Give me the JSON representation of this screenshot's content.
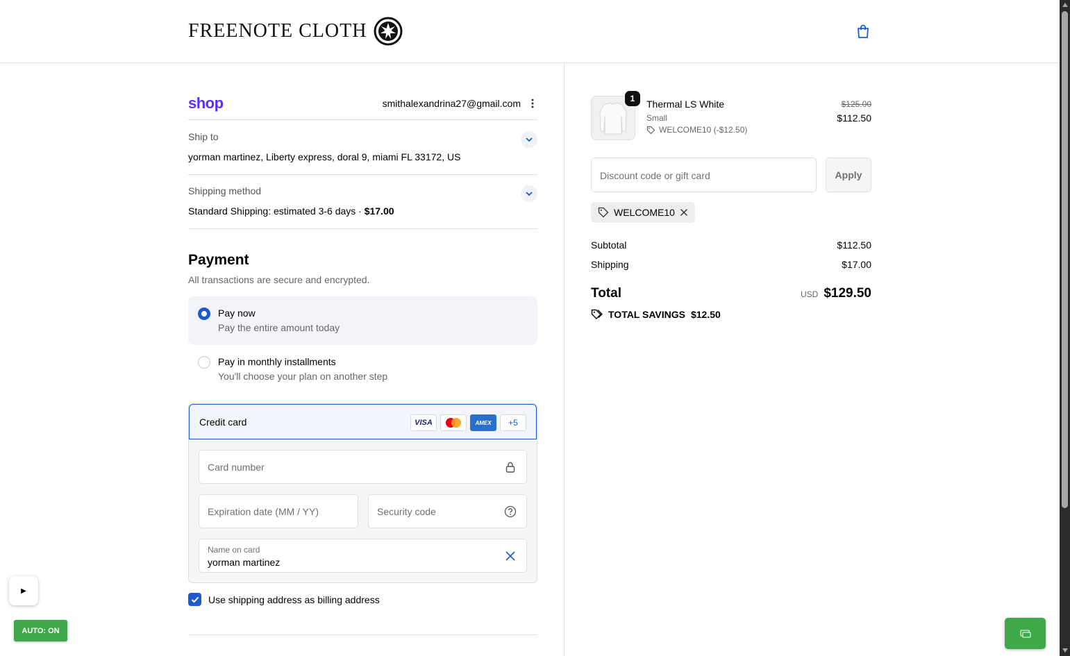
{
  "header": {
    "logo": "FREENOTE CLOTH",
    "cart_icon": "shopping-bag-icon"
  },
  "account": {
    "shop_logo": "shop",
    "email": "smithalexandrina27@gmail.com",
    "menu_icon": "kebab-menu-icon"
  },
  "ship_to": {
    "label": "Ship to",
    "value": "yorman martinez, Liberty express, doral 9, miami FL 33172, US"
  },
  "shipping_method": {
    "label": "Shipping method",
    "value": "Standard Shipping: estimated 3-6 days · ",
    "price": "$17.00"
  },
  "payment": {
    "title": "Payment",
    "subtitle": "All transactions are secure and encrypted.",
    "options": [
      {
        "title": "Pay now",
        "subtitle": "Pay the entire amount today",
        "selected": true
      },
      {
        "title": "Pay in monthly installments",
        "subtitle": "You'll choose your plan on another step",
        "selected": false
      }
    ],
    "credit_card": {
      "title": "Credit card",
      "brands": [
        "VISA",
        "Mastercard",
        "AMEX",
        "+5"
      ],
      "card_number_placeholder": "Card number",
      "expiration_placeholder": "Expiration date (MM / YY)",
      "security_placeholder": "Security code",
      "name_label": "Name on card",
      "name_value": "yorman martinez"
    },
    "billing_checkbox_label": "Use shipping address as billing address",
    "billing_checked": true
  },
  "order": {
    "item": {
      "name": "Thermal LS White",
      "variant": "Small",
      "discount": "WELCOME10 (-$12.50)",
      "quantity": "1",
      "original_price": "$125.00",
      "price": "$112.50"
    },
    "discount_placeholder": "Discount code or gift card",
    "apply_label": "Apply",
    "applied_code": "WELCOME10",
    "subtotal_label": "Subtotal",
    "subtotal": "$112.50",
    "shipping_label": "Shipping",
    "shipping": "$17.00",
    "total_label": "Total",
    "currency": "USD",
    "total": "$129.50",
    "savings_label": "TOTAL SAVINGS",
    "savings": "$12.50"
  },
  "overlay": {
    "play_icon": "▶",
    "auto_label": "AUTO: ON"
  },
  "colors": {
    "accent": "#1a5ccf",
    "shop_purple": "#5a31f4",
    "green": "#3fa94a"
  }
}
